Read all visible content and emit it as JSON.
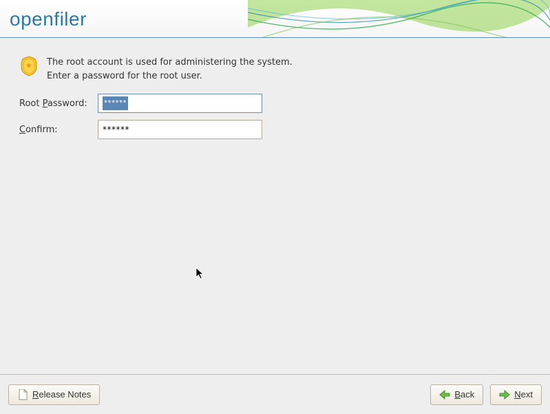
{
  "header": {
    "logo_text": "openfiler"
  },
  "intro": {
    "line1": "The root account is used for administering the system.",
    "line2": "Enter a password for the root user."
  },
  "form": {
    "password_label_pre": "Root ",
    "password_label_u": "P",
    "password_label_post": "assword:",
    "password_value_mask": "******",
    "confirm_label_u": "C",
    "confirm_label_post": "onfirm:",
    "confirm_value_mask": "******"
  },
  "footer": {
    "release_u": "R",
    "release_post": "elease Notes",
    "back_u": "B",
    "back_post": "ack",
    "next_u": "N",
    "next_post": "ext"
  }
}
